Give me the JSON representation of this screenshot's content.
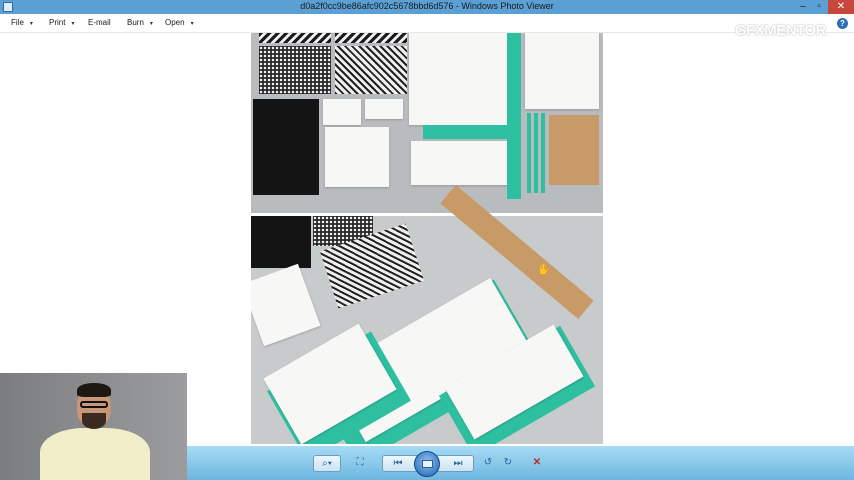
{
  "window": {
    "title": "d0a2f0cc9be86afc902c5678bbd6d576 - Windows Photo Viewer",
    "controls": {
      "minimize": "‒",
      "maximize": "▫",
      "close": "✕"
    }
  },
  "menu": {
    "file": "File",
    "print": "Print",
    "email": "E-mail",
    "burn": "Burn",
    "open": "Open",
    "caret": "▾",
    "help": "?"
  },
  "watermark": "GFXMENTOR",
  "toolbar": {
    "zoom": "⌕▾",
    "fit": "⛶",
    "previous": "⏮",
    "next": "⏭",
    "rotate_ccw": "↺",
    "rotate_cw": "↻",
    "delete": "✕"
  },
  "icons": {
    "app": "photo-viewer-icon",
    "cursor": "hand-cursor-icon"
  },
  "colors": {
    "titlebar": "#5aa0d4",
    "toolbar": "#7ec3e8",
    "accent_teal": "#2ebfa0",
    "close": "#c7473d"
  }
}
